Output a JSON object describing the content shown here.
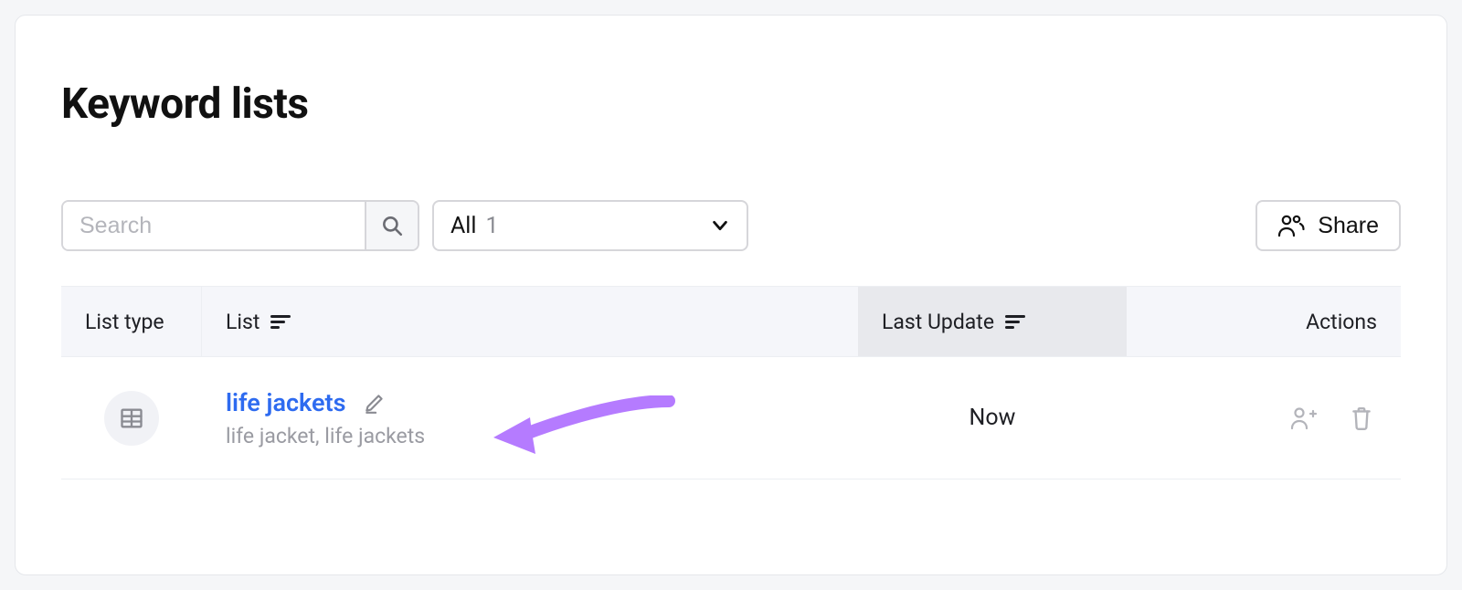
{
  "page_title": "Keyword lists",
  "search": {
    "placeholder": "Search"
  },
  "filter": {
    "label": "All",
    "count": "1"
  },
  "share_label": "Share",
  "table": {
    "headers": {
      "list_type": "List type",
      "list": "List",
      "last_update": "Last Update",
      "actions": "Actions"
    },
    "rows": [
      {
        "title": "life jackets",
        "subtitle": "life jacket, life jackets",
        "last_update": "Now"
      }
    ]
  }
}
